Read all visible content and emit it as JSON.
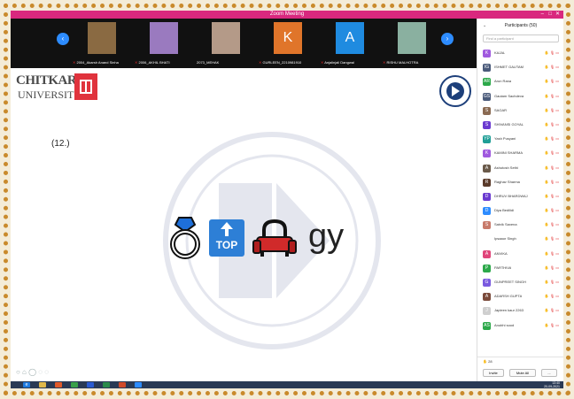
{
  "window": {
    "title": "Zoom Meeting",
    "controls": [
      "–",
      "□",
      "✕"
    ]
  },
  "gallery": {
    "prev": "‹",
    "next": "›",
    "tiles": [
      {
        "name": "2004_Akarsh Anand Sinha",
        "type": "photo",
        "color": "#8a6a42",
        "muted": true
      },
      {
        "name": "2006_AKHIL BHATI",
        "type": "photo",
        "color": "#9a7abf",
        "muted": true
      },
      {
        "name": "2073_MEHAK",
        "type": "photo",
        "color": "#b49a88",
        "muted": false
      },
      {
        "name": "GURLEEN_2210981910",
        "type": "letter",
        "letter": "K",
        "color": "#e0752a",
        "muted": true
      },
      {
        "name": "Anjalinjali Dangwal",
        "type": "letter",
        "letter": "A",
        "color": "#1f8be0",
        "muted": true
      },
      {
        "name": "RISHU MALHOTRA",
        "type": "photo",
        "color": "#8ab0a0",
        "muted": true
      }
    ]
  },
  "slide": {
    "brand_top": "CHITKARA",
    "brand_bottom": "UNIVERSITY",
    "question_number": "(12.)",
    "rebus_word": "TOP",
    "rebus_text": "gy"
  },
  "participants": {
    "title": "Participants (50)",
    "search_placeholder": "Find a participant",
    "hands_count": "28",
    "invite_label": "Invite",
    "mute_all_label": "Mute All",
    "more_label": "...",
    "list": [
      {
        "name": "KAJAL",
        "initials": "K",
        "color": "#a05adf"
      },
      {
        "name": "ISHMET GAUTAM",
        "initials": "IG",
        "color": "#4a5a7a"
      },
      {
        "name": "Arun Rana",
        "initials": "AR",
        "color": "#2ca84a"
      },
      {
        "name": "Gautam Sachdeva",
        "initials": "GS",
        "color": "#4a5a7a"
      },
      {
        "name": "SAGAR",
        "initials": "S",
        "color": "#8a6a52"
      },
      {
        "name": "SHIVANSI GOYAL",
        "initials": "S",
        "color": "#6a3ad0"
      },
      {
        "name": "Yash Pusyani",
        "initials": "YP",
        "color": "#1f9e96"
      },
      {
        "name": "KAMINI SHARMA",
        "initials": "K",
        "color": "#a05adf"
      },
      {
        "name": "Ashutosh Sethi",
        "initials": "A",
        "color": "#6a5a4a"
      },
      {
        "name": "Raghav Sharma",
        "initials": "R",
        "color": "#5a3a2a"
      },
      {
        "name": "DHRUV BHARDWAJ",
        "initials": "D",
        "color": "#6a3ad0"
      },
      {
        "name": "Diya Bedilidi",
        "initials": "D",
        "color": "#2d8cff"
      },
      {
        "name": "Satvik Saxena",
        "initials": "S",
        "color": "#c87a6a"
      },
      {
        "name": "Ipsaaor Singh",
        "initials": "",
        "color": "#ffffff"
      },
      {
        "name": "ANVIKA",
        "initials": "A",
        "color": "#e0457a"
      },
      {
        "name": "PARTHIVA",
        "initials": "P",
        "color": "#2ca84a"
      },
      {
        "name": "GUNPREET SINGH",
        "initials": "G",
        "color": "#7a5adf"
      },
      {
        "name": "ADARSH GUPTA",
        "initials": "A",
        "color": "#7a4a3a"
      },
      {
        "name": "Japleen kaur 2263",
        "initials": "J",
        "color": "#cfcfcf"
      },
      {
        "name": "Anubhi sood",
        "initials": "AS",
        "color": "#2ca84a"
      }
    ]
  },
  "taskbar": {
    "time": "13:40",
    "date": "20-09-2021"
  }
}
